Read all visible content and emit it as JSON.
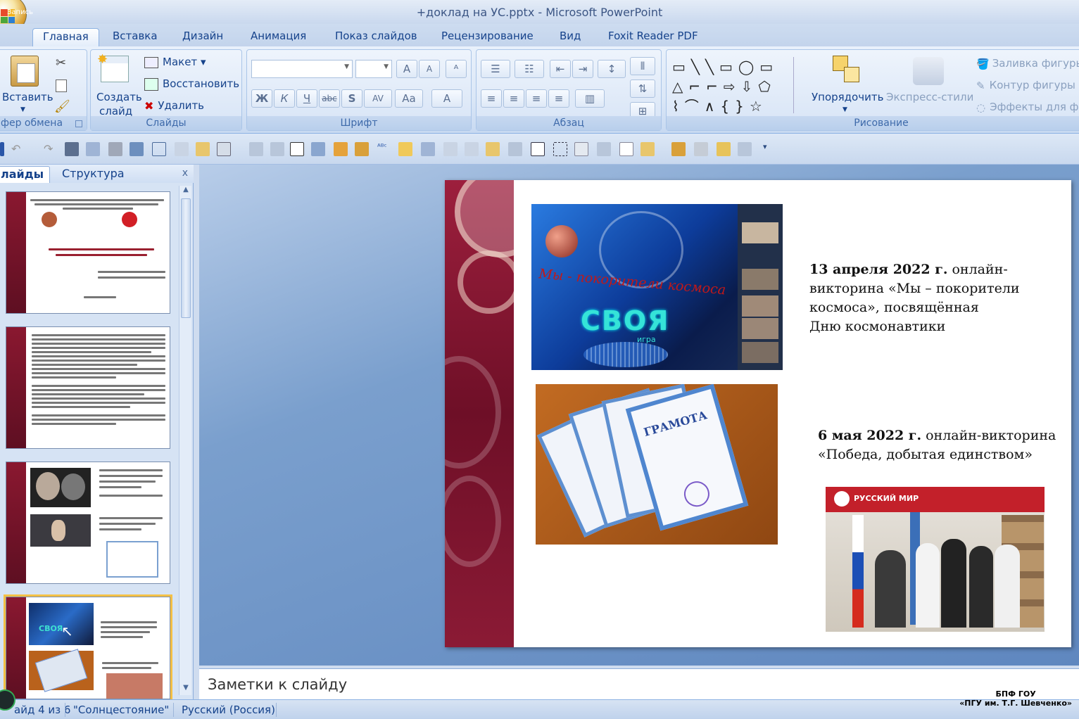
{
  "window": {
    "title": "+доклад на УС.pptx - Microsoft PowerPoint",
    "rec_label": "Запись"
  },
  "tabs": [
    "Главная",
    "Вставка",
    "Дизайн",
    "Анимация",
    "Показ слайдов",
    "Рецензирование",
    "Вид",
    "Foxit Reader PDF"
  ],
  "ribbon": {
    "clipboard": {
      "paste": "Вставить",
      "label": "фер обмена"
    },
    "slides": {
      "create": "Создать",
      "create2": "слайд",
      "layout": "Макет",
      "reset": "Восстановить",
      "delete": "Удалить",
      "label": "Слайды"
    },
    "font": {
      "bold": "Ж",
      "italic": "К",
      "underline": "Ч",
      "strike": "abc",
      "shadow": "S",
      "spacing": "AV",
      "case": "Aa",
      "color": "A",
      "grow": "A",
      "shrink": "A",
      "label": "Шрифт"
    },
    "paragraph": {
      "label": "Абзац"
    },
    "drawing": {
      "arrange": "Упорядочить",
      "quick_styles": "Экспресс-стили",
      "fill": "Заливка фигуры",
      "outline": "Контур фигуры",
      "effects": "Эффекты для фи",
      "label": "Рисование"
    }
  },
  "left_pane": {
    "tab_slides": "лайды",
    "tab_outline": "Структура",
    "close": "x"
  },
  "slide": {
    "event1_date": "13 апреля 2022 г.",
    "event1_text_a": " онлайн-",
    "event1_text_b": "викторина «Мы – покорители",
    "event1_text_c": "космоса», посвящённая",
    "event1_text_d": " Дню космонавтики",
    "event2_date": "6 мая 2022 г.",
    "event2_text_a": " онлайн-викторина",
    "event2_text_b": "«Победа, добытая единством»",
    "img1_caption": "Мы - покорители космоса",
    "img1_logo": "СВОЯ",
    "img1_logo_sub": "игра",
    "img2_word": "ГРАМОТА",
    "img3_banner": "РУССКИЙ МИР"
  },
  "notes": {
    "placeholder": "Заметки к слайду"
  },
  "status": {
    "slide": "айд 4 из 6",
    "theme": "\"Солнцестояние\"",
    "lang": "Русский (Россия)"
  },
  "watermark": {
    "line1": "БПФ ГОУ",
    "line2": "«ПГУ им. Т.Г. Шевченко»"
  }
}
